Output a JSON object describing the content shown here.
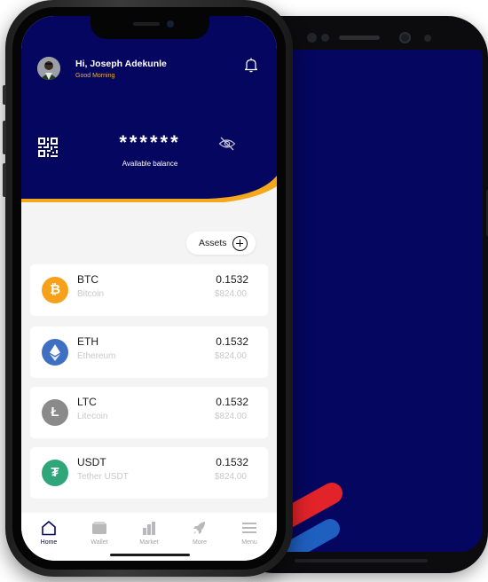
{
  "user": {
    "greeting": "Hi, Joseph Adekunle",
    "subtitle": "Good Morning"
  },
  "balance": {
    "masked_value": "******",
    "label": "Available balance"
  },
  "assets_button": {
    "label": "Assets"
  },
  "assets": [
    {
      "symbol": "BTC",
      "name": "Bitcoin",
      "amount": "0.1532",
      "value": "$824.00",
      "icon_glyph": "₿",
      "icon": "bitcoin-icon",
      "color": "#F7A11A"
    },
    {
      "symbol": "ETH",
      "name": "Ethereum",
      "amount": "0.1532",
      "value": "$824.00",
      "icon_glyph": "◆",
      "icon": "ethereum-icon",
      "color": "#3E6FC0"
    },
    {
      "symbol": "LTC",
      "name": "Litecoin",
      "amount": "0.1532",
      "value": "$824.00",
      "icon_glyph": "Ł",
      "icon": "litecoin-icon",
      "color": "#8A8A8A"
    },
    {
      "symbol": "USDT",
      "name": "Tether USDT",
      "amount": "0.1532",
      "value": "$824.00",
      "icon_glyph": "₮",
      "icon": "tether-icon",
      "color": "#2EA67A"
    }
  ],
  "nav": {
    "items": [
      {
        "label": "Home",
        "icon": "home-icon",
        "active": true
      },
      {
        "label": "Wallet",
        "icon": "wallet-icon",
        "active": false
      },
      {
        "label": "Market",
        "icon": "market-icon",
        "active": false
      },
      {
        "label": "More",
        "icon": "rocket-icon",
        "active": false
      },
      {
        "label": "Menu",
        "icon": "hamburger-icon",
        "active": false
      }
    ]
  },
  "colors": {
    "brand_navy": "#050660",
    "accent_orange": "#F5A81C",
    "background": "#F4F4F5"
  }
}
